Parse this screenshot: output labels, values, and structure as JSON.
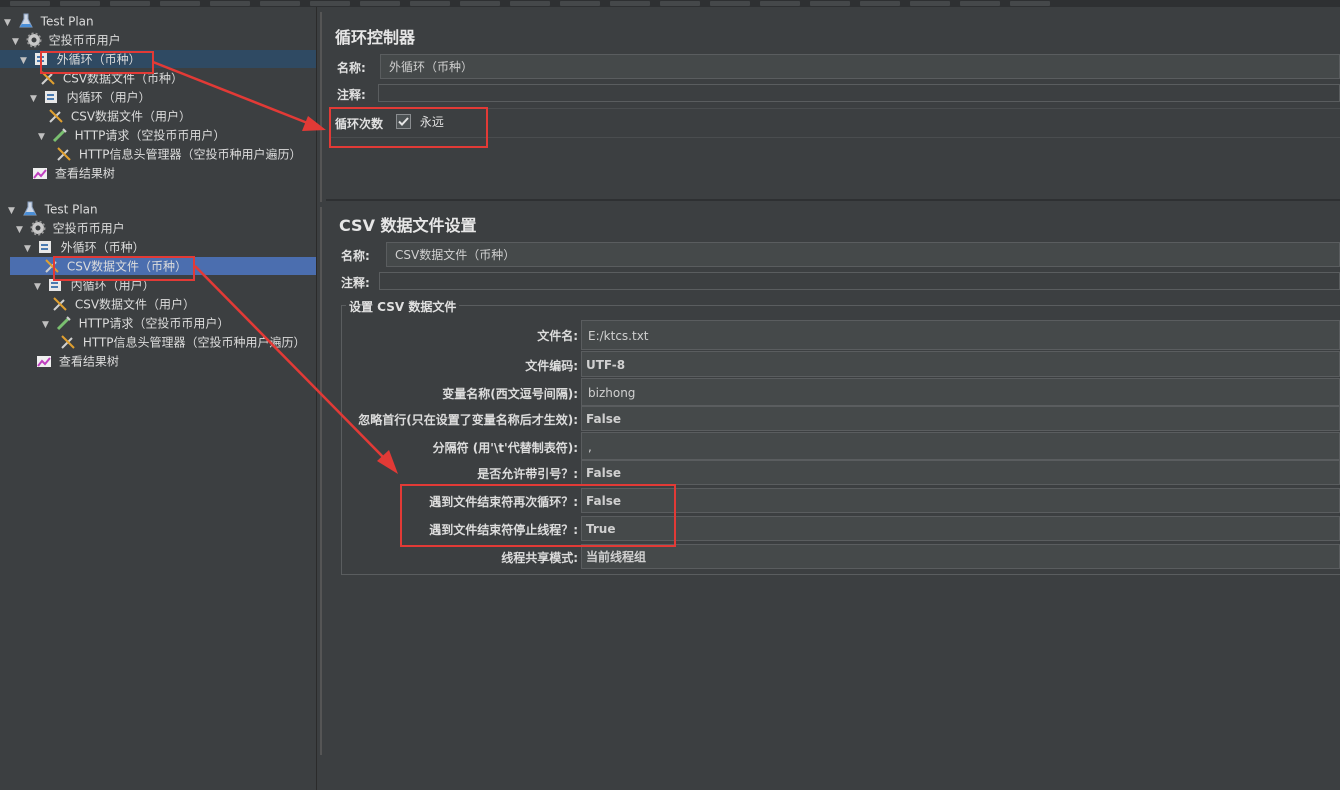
{
  "tree_top": {
    "items": [
      {
        "label": "Test Plan"
      },
      {
        "label": "空投币币用户"
      },
      {
        "label": "外循环（币种）"
      },
      {
        "label": "CSV数据文件（币种）"
      },
      {
        "label": "内循环（用户）"
      },
      {
        "label": "CSV数据文件（用户）"
      },
      {
        "label": "HTTP请求（空投币币用户）"
      },
      {
        "label": "HTTP信息头管理器（空投币种用户遍历）"
      },
      {
        "label": "查看结果树"
      }
    ]
  },
  "tree_bottom": {
    "items": [
      {
        "label": "Test Plan"
      },
      {
        "label": "空投币币用户"
      },
      {
        "label": "外循环（币种）"
      },
      {
        "label": "CSV数据文件（币种）"
      },
      {
        "label": "内循环（用户）"
      },
      {
        "label": "CSV数据文件（用户）"
      },
      {
        "label": "HTTP请求（空投币币用户）"
      },
      {
        "label": "HTTP信息头管理器（空投币种用户遍历）"
      },
      {
        "label": "查看结果树"
      }
    ]
  },
  "loop_panel": {
    "title": "循环控制器",
    "name_label": "名称:",
    "name_value": "外循环（币种）",
    "comment_label": "注释:",
    "loop_count_label": "循环次数",
    "forever_label": "永远",
    "forever_checked": true
  },
  "csv_panel": {
    "title": "CSV 数据文件设置",
    "name_label": "名称:",
    "name_value": "CSV数据文件（币种）",
    "comment_label": "注释:",
    "group_title": "设置 CSV 数据文件",
    "fields": [
      {
        "label": "文件名:",
        "value": "E:/ktcs.txt"
      },
      {
        "label": "文件编码:",
        "value": "UTF-8"
      },
      {
        "label": "变量名称(西文逗号间隔):",
        "value": "bizhong"
      },
      {
        "label": "忽略首行(只在设置了变量名称后才生效):",
        "value": "False"
      },
      {
        "label": "分隔符 (用'\\t'代替制表符):",
        "value": ","
      },
      {
        "label": "是否允许带引号？:",
        "value": "False"
      },
      {
        "label": "遇到文件结束符再次循环？:",
        "value": "False"
      },
      {
        "label": "遇到文件结束符停止线程？:",
        "value": "True"
      },
      {
        "label": "线程共享模式:",
        "value": "当前线程组"
      }
    ]
  },
  "colors": {
    "annotation": "#e23a36",
    "background": "#3c3f41",
    "selection": "#4b6eaf"
  }
}
